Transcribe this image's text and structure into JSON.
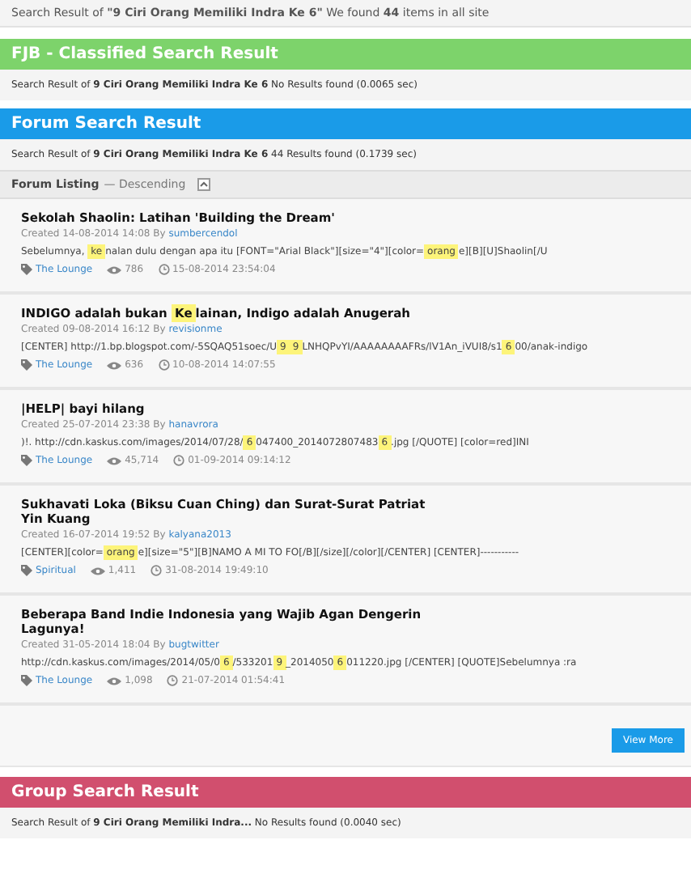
{
  "summary": "Search Result of **\"9 Ciri Orang Memiliki Indra Ke 6\"** We found **44** items in all site",
  "sections": [
    {
      "kind": "fjb",
      "title": "FJB - Classified Search Result",
      "color": "#7dd36b",
      "info": "Search Result of **9 Ciri Orang Memiliki Indra Ke 6**  No Results found (0.0065 sec)"
    },
    {
      "kind": "forum",
      "title": "Forum Search Result",
      "color": "#1a9be8",
      "info": "Search Result of **9 Ciri Orang Memiliki Indra Ke 6** 44 Results found (0.1739 sec)",
      "listing": {
        "label": "Forum Listing",
        "order": "— Descending",
        "expanded": true
      },
      "items": [
        {
          "title": "Sekolah Shaolin: Latihan 'Building the Dream'",
          "created": "Created 14-08-2014 14:08 By",
          "author": "sumbercendol",
          "snippet": [
            {
              "text": "Sebelumnya, ",
              "highlight": false
            },
            {
              "text": "ke",
              "highlight": true
            },
            {
              "text": "nalan dulu dengan apa itu [FONT=\"Arial Black\"][size=\"4\"][color=",
              "highlight": false
            },
            {
              "text": "orang",
              "highlight": true
            },
            {
              "text": "e][B][U]Shaolin[/U",
              "highlight": false
            }
          ],
          "forum": "The Lounge",
          "views": "786",
          "date": "15-08-2014 23:54:04"
        },
        {
          "title": "INDIGO adalah bukan ",
          "titleHighlight": "Ke",
          "titleRest": "lainan, Indigo adalah Anugerah",
          "created": "Created 09-08-2014 16:12 By",
          "author": "revisionme",
          "snippet": [
            {
              "text": "[CENTER] http://1.bp.blogspot.com/-5SQAQ51soec/U",
              "highlight": false
            },
            {
              "text": "9",
              "highlight": true
            },
            {
              "text": "9",
              "highlight": true
            },
            {
              "text": "LNHQPvYI/AAAAAAAAFRs/lV1An_iVUI8/s1",
              "highlight": false
            },
            {
              "text": "6",
              "highlight": true
            },
            {
              "text": "00/anak-indigo",
              "highlight": false
            }
          ],
          "forum": "The Lounge",
          "views": "636",
          "date": "10-08-2014 14:07:55"
        },
        {
          "title": "|HELP| bayi hilang",
          "created": "Created 25-07-2014 23:38 By",
          "author": "hanavrora",
          "snippet": [
            {
              "text": ")!. http://cdn.kaskus.com/images/2014/07/28/",
              "highlight": false
            },
            {
              "text": "6",
              "highlight": true
            },
            {
              "text": "047400_2014072807483",
              "highlight": false
            },
            {
              "text": "6",
              "highlight": true
            },
            {
              "text": ".jpg [/QUOTE] [color=red]INI",
              "highlight": false
            }
          ],
          "forum": "The Lounge",
          "views": "45,714",
          "date": "01-09-2014 09:14:12"
        },
        {
          "title": "Sukhavati Loka (Biksu Cuan Ching) dan Surat-Surat Patriat Yin Kuang",
          "created": "Created 16-07-2014 19:52 By",
          "author": "kalyana2013",
          "snippet": [
            {
              "text": "[CENTER][color=",
              "highlight": false
            },
            {
              "text": "orang",
              "highlight": true
            },
            {
              "text": "e][size=\"5\"][B]NAMO A MI TO FO[/B][/size][/color][/CENTER] [CENTER]-----------",
              "highlight": false
            }
          ],
          "forum": "Spiritual",
          "views": "1,411",
          "date": "31-08-2014 19:49:10"
        },
        {
          "title": "Beberapa Band Indie Indonesia yang Wajib Agan Dengerin Lagunya!",
          "created": "Created 31-05-2014 18:04 By",
          "author": "bugtwitter",
          "snippet": [
            {
              "text": "http://cdn.kaskus.com/images/2014/05/0",
              "highlight": false
            },
            {
              "text": "6",
              "highlight": true
            },
            {
              "text": "/533201",
              "highlight": false
            },
            {
              "text": "9",
              "highlight": true
            },
            {
              "text": "_2014050",
              "highlight": false
            },
            {
              "text": "6",
              "highlight": true
            },
            {
              "text": "011220.jpg [/CENTER] [QUOTE]Sebelumnya :ra",
              "highlight": false
            }
          ],
          "forum": "The Lounge",
          "views": "1,098",
          "date": "21-07-2014 01:54:41"
        }
      ],
      "view_more": "View More"
    },
    {
      "kind": "group",
      "title": "Group Search Result",
      "color": "#d14f6e",
      "info": "Search Result of **9 Ciri Orang Memiliki Indra...** No Results found (0.0040 sec)"
    }
  ]
}
